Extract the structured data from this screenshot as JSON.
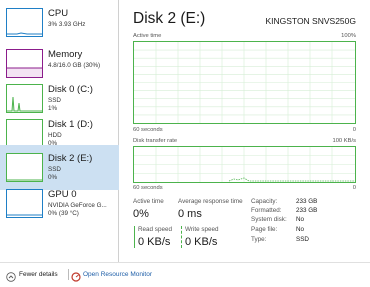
{
  "sidebar": {
    "items": [
      {
        "title": "CPU",
        "line1": "3% 3.93 GHz",
        "line2": "",
        "color": "#1f7fc6"
      },
      {
        "title": "Memory",
        "line1": "4.8/16.0 GB (30%)",
        "line2": "",
        "color": "#8b1c8b"
      },
      {
        "title": "Disk 0 (C:)",
        "line1": "SSD",
        "line2": "1%",
        "color": "#4cb34c"
      },
      {
        "title": "Disk 1 (D:)",
        "line1": "HDD",
        "line2": "0%",
        "color": "#4cb34c"
      },
      {
        "title": "Disk 2 (E:)",
        "line1": "SSD",
        "line2": "0%",
        "color": "#4cb34c"
      },
      {
        "title": "GPU 0",
        "line1": "NVIDIA GeForce G...",
        "line2": "0% (39 °C)",
        "color": "#1f7fc6"
      }
    ]
  },
  "main": {
    "title": "Disk 2 (E:)",
    "model": "KINGSTON SNVS250G",
    "graph1": {
      "label": "Active time",
      "max": "100%",
      "time": "60 seconds",
      "min": "0"
    },
    "graph2": {
      "label": "Disk transfer rate",
      "max": "100 KB/s",
      "time": "60 seconds",
      "min": "0"
    },
    "stats": {
      "active_time_label": "Active time",
      "active_time_value": "0%",
      "response_label": "Average response time",
      "response_value": "0 ms",
      "read_label": "Read speed",
      "read_value": "0 KB/s",
      "write_label": "Write speed",
      "write_value": "0 KB/s"
    },
    "props": [
      {
        "k": "Capacity:",
        "v": "233 GB"
      },
      {
        "k": "Formatted:",
        "v": "233 GB"
      },
      {
        "k": "System disk:",
        "v": "No"
      },
      {
        "k": "Page file:",
        "v": "No"
      },
      {
        "k": "Type:",
        "v": "SSD"
      }
    ]
  },
  "footer": {
    "fewer_details": "Fewer details",
    "open_monitor": "Open Resource Monitor"
  },
  "colors": {
    "disk_green": "#4cb34c",
    "selected": "#cce0f2"
  }
}
